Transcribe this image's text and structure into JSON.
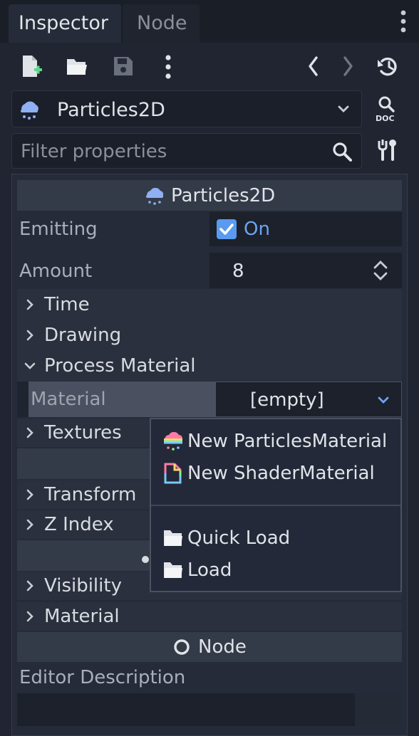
{
  "tabs": [
    {
      "label": "Inspector",
      "active": true
    },
    {
      "label": "Node",
      "active": false
    }
  ],
  "toolbar": {
    "icons": [
      "new-resource-icon",
      "open-folder-icon",
      "save-icon",
      "more-vertical-icon",
      "back-icon",
      "forward-icon",
      "history-icon"
    ]
  },
  "object_selector": {
    "value": "Particles2D",
    "icon": "particles-icon",
    "doc_icon": "doc-icon"
  },
  "filter": {
    "placeholder": "Filter properties",
    "search_icon": "search-icon",
    "tools_icon": "tools-icon"
  },
  "inspector": {
    "class_header": "Particles2D",
    "emitting": {
      "label": "Emitting",
      "checked": true,
      "value_text": "On"
    },
    "amount": {
      "label": "Amount",
      "value": "8"
    },
    "groups": {
      "time": "Time",
      "drawing": "Drawing",
      "process_material": "Process Material",
      "textures": "Textures",
      "transform": "Transform",
      "z_index": "Z Index",
      "visibility": "Visibility",
      "material": "Material"
    },
    "material_row": {
      "label": "Material",
      "value": "[empty]"
    },
    "node_header": "Node",
    "editor_description": "Editor Description"
  },
  "popup_menu": {
    "items": [
      {
        "label": "New ParticlesMaterial",
        "icon": "particles-material-icon"
      },
      {
        "label": "New ShaderMaterial",
        "icon": "shader-material-icon"
      },
      {
        "label": "Quick Load",
        "icon": "folder-icon"
      },
      {
        "label": "Load",
        "icon": "folder-icon"
      }
    ]
  },
  "colors": {
    "background": "#202531",
    "panel": "#252b38",
    "accent": "#6ea3f0",
    "checkbox": "#5a9af0",
    "text": "#ccd0d8"
  }
}
